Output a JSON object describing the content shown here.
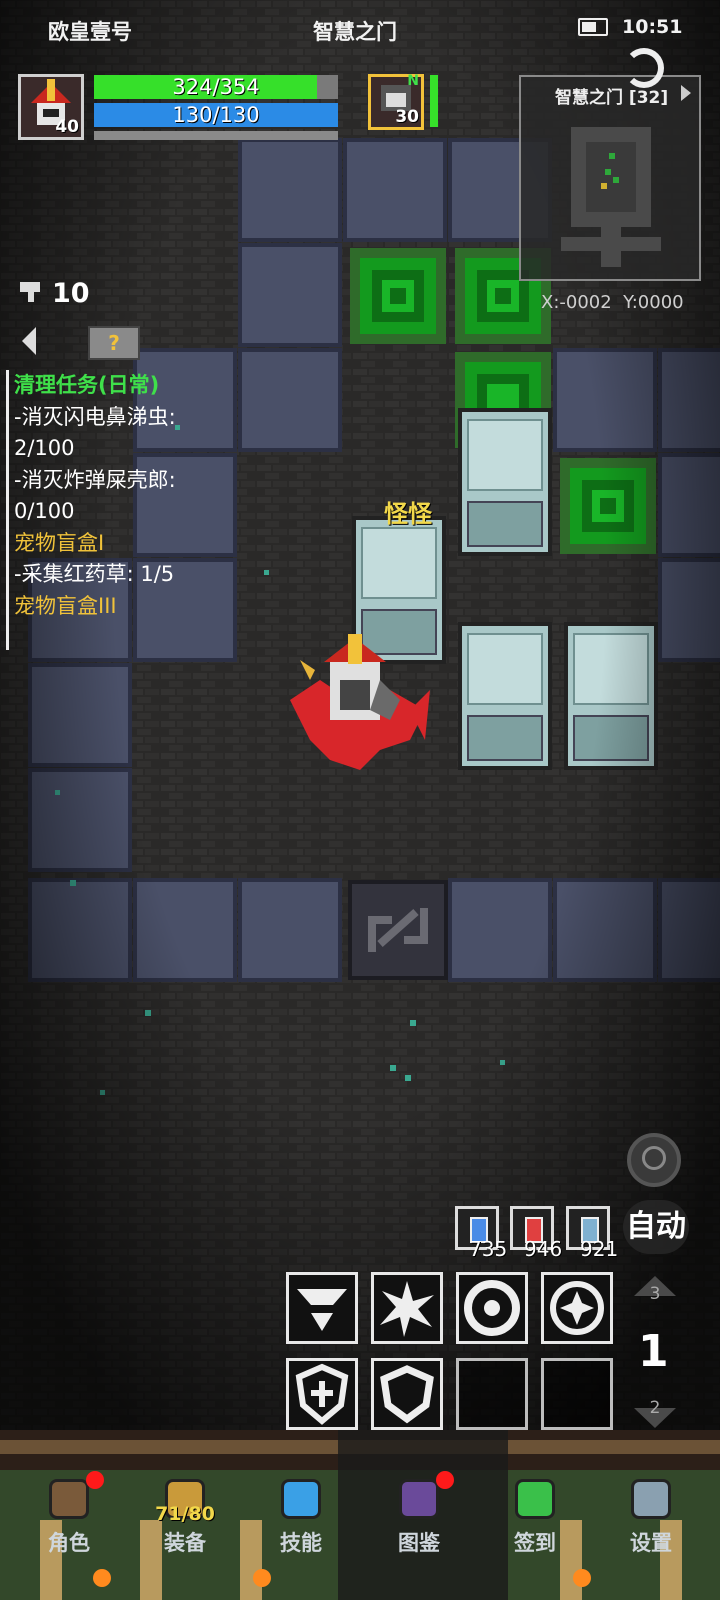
{
  "status_bar": {
    "player_name": "欧皇壹号",
    "location": "智慧之门",
    "time": "10:51"
  },
  "player": {
    "level": "40",
    "hp": "324/354",
    "hp_fraction": 0.915,
    "mp": "130/130",
    "mp_fraction": 1.0,
    "xp_fraction": 0.0
  },
  "companion": {
    "level": "30",
    "badge": "N",
    "hp_fraction": 1.0
  },
  "minimap": {
    "title": "智慧之门 [32]",
    "coords": "X:-0002  Y:0000"
  },
  "keys": {
    "count": "10"
  },
  "quests": [
    {
      "text": "清理任务(日常)",
      "color": "#3fe04a"
    },
    {
      "text": "-消灭闪电鼻涕虫:",
      "color": "#ffffff"
    },
    {
      "text": "2/100",
      "color": "#ffffff"
    },
    {
      "text": "-消灭炸弹屎壳郎:",
      "color": "#ffffff"
    },
    {
      "text": "0/100",
      "color": "#ffffff"
    },
    {
      "text": "宠物盲盒I",
      "color": "#f0c23a"
    },
    {
      "text": "-采集红药草: 1/5",
      "color": "#ffffff"
    },
    {
      "text": "宠物盲盒III",
      "color": "#f0c23a"
    }
  ],
  "world": {
    "monster_label": "怪怪"
  },
  "consumables": [
    {
      "name": "blue-potion-icon",
      "count": "735"
    },
    {
      "name": "red-potion-icon",
      "count": "946"
    },
    {
      "name": "fish-icon",
      "count": "921"
    }
  ],
  "auto_label": "自动",
  "floor": {
    "up": "3",
    "current": "1",
    "down": "2"
  },
  "nav": [
    {
      "label": "角色",
      "icon": "helmet-icon",
      "badge": true
    },
    {
      "label": "装备",
      "icon": "equipment-icon",
      "badge": false,
      "count": "71/80"
    },
    {
      "label": "技能",
      "icon": "skill-gem-icon",
      "badge": false
    },
    {
      "label": "图鉴",
      "icon": "book-icon",
      "badge": true
    },
    {
      "label": "签到",
      "icon": "green-gem-icon",
      "badge": false
    },
    {
      "label": "设置",
      "icon": "gear-icon",
      "badge": false
    }
  ],
  "colors": {
    "hp": "#36e02a",
    "mp": "#2b8be6",
    "quest_title": "#3fe04a",
    "quest_pet": "#f0c23a"
  }
}
